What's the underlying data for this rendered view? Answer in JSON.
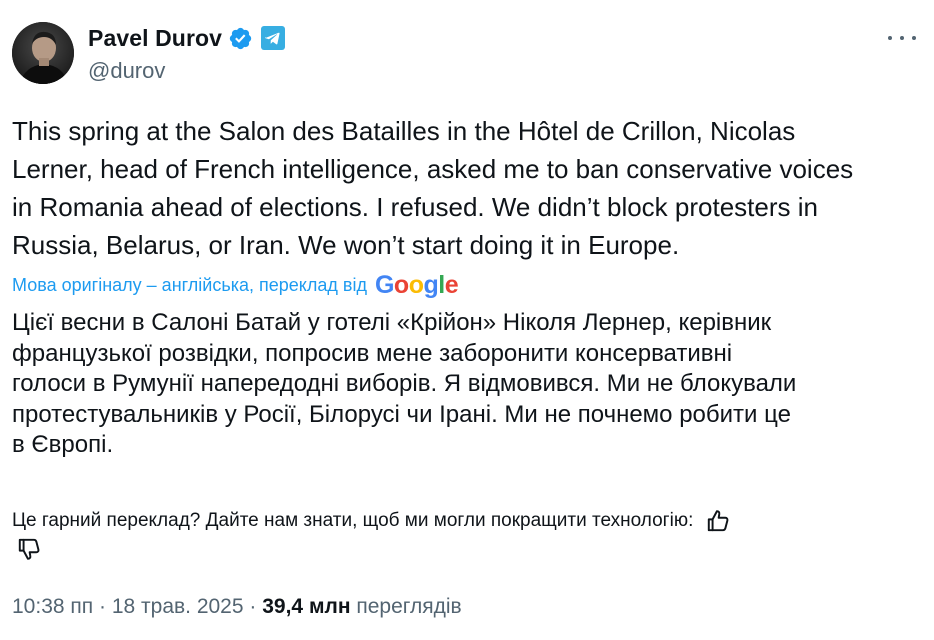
{
  "author": {
    "display_name": "Pavel Durov",
    "handle": "@durov",
    "verified_icon": "verified-badge-icon",
    "affiliate_icon": "telegram-icon"
  },
  "tweet": {
    "text": "This spring at the Salon des Batailles in the Hôtel de Crillon, Nicolas\nLerner, head of French intelligence, asked me to ban conservative voices\nin Romania ahead of elections. I refused. We didn’t block protesters in\nRussia, Belarus, or Iran. We won’t start doing it in Europe."
  },
  "translation": {
    "label": "Мова оригіналу – англійська, переклад від",
    "provider": "Google",
    "text": "Цієї весни в Салоні Батай у готелі «Крійон» Ніколя Лернер, керівник\nфранцузької розвідки, попросив мене заборонити консервативні\nголоси в Румунії напередодні виборів. Я відмовився. Ми не блокували\nпротестувальників у Росії, Білорусі чи Ірані. Ми не почнемо робити це\nв Європі.",
    "feedback_prompt": "Це гарний переклад? Дайте нам знати, щоб ми могли покращити технологію:"
  },
  "meta": {
    "time": "10:38 пп",
    "separator": "·",
    "date": "18 трав. 2025",
    "views_count": "39,4 млн",
    "views_label": "переглядів"
  },
  "colors": {
    "text": "#0f1419",
    "secondary": "#536471",
    "accent": "#1d9bf0",
    "google_blue": "#4285F4",
    "google_red": "#EA4335",
    "google_yellow": "#FBBC05",
    "google_green": "#34A853"
  },
  "icons": {
    "more": "more-icon",
    "thumbs_up": "thumbs-up-icon",
    "thumbs_down": "thumbs-down-icon"
  }
}
